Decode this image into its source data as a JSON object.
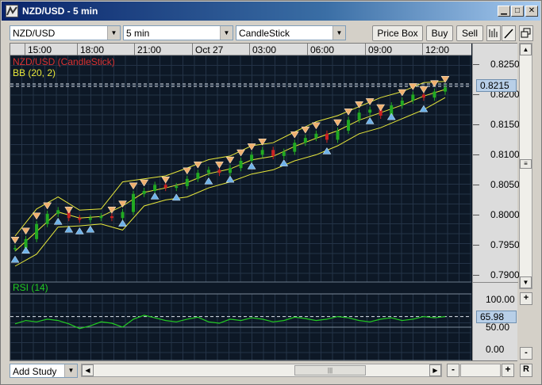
{
  "window": {
    "title": "NZD/USD - 5 min"
  },
  "icons": {
    "app": "wave-logo-icon",
    "minimize": "minimize-icon",
    "maximize": "maximize-icon",
    "close": "close-icon"
  },
  "toolbar": {
    "symbol": "NZD/USD",
    "interval": "5 min",
    "chart_type": "CandleStick",
    "price_box": "Price Box",
    "buy": "Buy",
    "sell": "Sell"
  },
  "legend": {
    "main": "NZD/USD (CandleStick)",
    "bb": "BB (20, 2)",
    "rsi": "RSI (14)"
  },
  "colors": {
    "bg": "#0d1826",
    "grid": "#243347",
    "bb": "#e8e83a",
    "rsi": "#22cc22",
    "up": "#22aa22",
    "down": "#cc2222",
    "buy_arrow": "#6fb2e8",
    "sell_arrow": "#f0b070"
  },
  "bottom": {
    "add_study": "Add Study",
    "reset": "R",
    "zoom_out": "-",
    "zoom_in": "+",
    "v_zoom_in": "+",
    "v_zoom_out": "-"
  },
  "chart_data": {
    "type": "line",
    "title": "NZD/USD (CandleStick)",
    "x_ticks": [
      "15:00",
      "18:00",
      "21:00",
      "Oct 27",
      "03:00",
      "06:00",
      "09:00",
      "12:00"
    ],
    "y_ticks": [
      0.825,
      0.82,
      0.815,
      0.81,
      0.805,
      0.8,
      0.795,
      0.79
    ],
    "y_tick_labels": [
      "0.8250",
      "0.8200",
      "0.8150",
      "0.8100",
      "0.8050",
      "0.8000",
      "0.7950",
      "0.7900"
    ],
    "ylim": [
      0.789,
      0.8265
    ],
    "current_price": 0.8215,
    "current_price_label": "0.8215",
    "series": [
      {
        "name": "NZD/USD",
        "x": [
          0,
          1,
          2,
          3,
          4,
          5,
          6,
          7,
          8,
          9,
          10,
          11,
          12,
          13,
          14,
          15,
          16,
          17,
          18,
          19,
          20,
          21,
          22,
          23,
          24,
          25,
          26,
          27,
          28,
          29,
          30,
          31,
          32,
          33,
          34,
          35,
          36,
          37,
          38,
          39,
          40
        ],
        "values": [
          0.7945,
          0.796,
          0.7985,
          0.8002,
          0.8008,
          0.7995,
          0.7992,
          0.7995,
          0.7998,
          0.7995,
          0.8005,
          0.8035,
          0.804,
          0.805,
          0.8045,
          0.8048,
          0.806,
          0.807,
          0.8075,
          0.807,
          0.8078,
          0.809,
          0.81,
          0.8108,
          0.8098,
          0.8105,
          0.812,
          0.8128,
          0.8135,
          0.8125,
          0.814,
          0.8158,
          0.817,
          0.8175,
          0.8165,
          0.8182,
          0.819,
          0.82,
          0.8195,
          0.8205,
          0.8212
        ]
      },
      {
        "name": "BB upper",
        "x": [
          0,
          2,
          4,
          6,
          8,
          10,
          12,
          14,
          16,
          18,
          20,
          22,
          24,
          26,
          28,
          30,
          32,
          34,
          36,
          38,
          40
        ],
        "values": [
          0.7965,
          0.801,
          0.803,
          0.8008,
          0.801,
          0.8055,
          0.806,
          0.8065,
          0.8078,
          0.8092,
          0.8098,
          0.8115,
          0.812,
          0.8138,
          0.8155,
          0.8165,
          0.818,
          0.8195,
          0.8205,
          0.822,
          0.8222
        ]
      },
      {
        "name": "BB lower",
        "x": [
          0,
          2,
          4,
          6,
          8,
          10,
          12,
          14,
          16,
          18,
          20,
          22,
          24,
          26,
          28,
          30,
          32,
          34,
          36,
          38,
          40
        ],
        "values": [
          0.7915,
          0.7935,
          0.798,
          0.7982,
          0.7985,
          0.7975,
          0.8015,
          0.8025,
          0.803,
          0.8045,
          0.8055,
          0.8068,
          0.8075,
          0.809,
          0.81,
          0.8115,
          0.8135,
          0.8145,
          0.816,
          0.8175,
          0.8195
        ]
      }
    ],
    "sell_markers_x": [
      0,
      1,
      2,
      3,
      5,
      9,
      10,
      11,
      12,
      14,
      16,
      17,
      19,
      20,
      21,
      22,
      23,
      26,
      27,
      28,
      30,
      31,
      32,
      33,
      34,
      36,
      37,
      38,
      39,
      40
    ],
    "buy_markers_x": [
      0,
      1,
      4,
      5,
      6,
      7,
      10,
      13,
      15,
      18,
      20,
      22,
      25,
      29,
      33,
      35,
      38
    ],
    "rsi": {
      "name": "RSI (14)",
      "y_tick_labels": [
        "100.00",
        "50.00",
        "0.00"
      ],
      "ylim": [
        0,
        100
      ],
      "current_label": "65.98",
      "current": 65.98,
      "values": [
        55,
        60,
        58,
        62,
        60,
        55,
        48,
        52,
        58,
        56,
        50,
        62,
        68,
        64,
        60,
        58,
        62,
        65,
        58,
        56,
        62,
        60,
        64,
        62,
        58,
        60,
        65,
        63,
        60,
        62,
        66,
        64,
        60,
        58,
        62,
        64,
        60,
        62,
        66,
        64,
        66
      ]
    }
  }
}
